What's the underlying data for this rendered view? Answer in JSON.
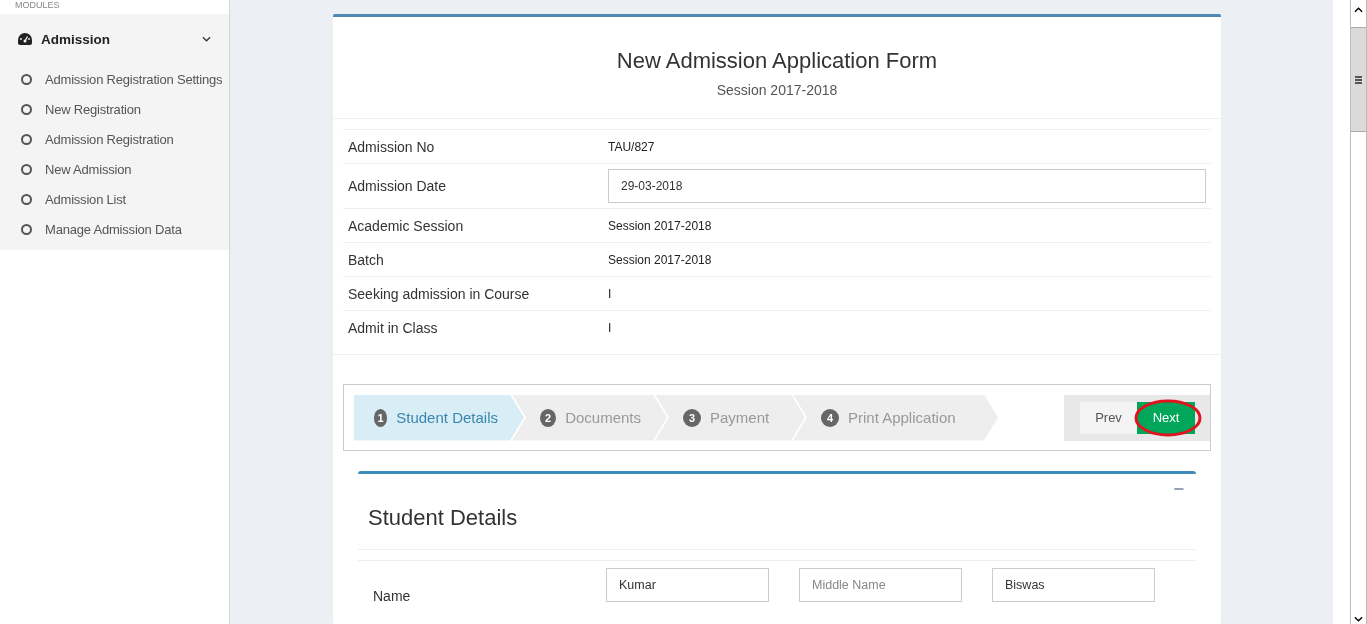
{
  "sidebar": {
    "section_label": "MODULES",
    "module": {
      "label": "Admission",
      "expanded": true
    },
    "items": [
      {
        "label": "Admission Registration Settings"
      },
      {
        "label": "New Registration"
      },
      {
        "label": "Admission Registration"
      },
      {
        "label": "New Admission"
      },
      {
        "label": "Admission List"
      },
      {
        "label": "Manage Admission Data"
      }
    ]
  },
  "form": {
    "title": "New Admission Application Form",
    "session": "Session 2017-2018",
    "fields": [
      {
        "kind": "text",
        "label": "Admission No",
        "value": "TAU/827"
      },
      {
        "kind": "input",
        "label": "Admission Date",
        "value": "29-03-2018"
      },
      {
        "kind": "text",
        "label": "Academic Session",
        "value": "Session 2017-2018"
      },
      {
        "kind": "text",
        "label": "Batch",
        "value": "Session 2017-2018"
      },
      {
        "kind": "text",
        "label": "Seeking admission in Course",
        "value": "I"
      },
      {
        "kind": "text",
        "label": "Admit in Class",
        "value": "I"
      }
    ]
  },
  "wizard": {
    "steps": [
      {
        "number": "1",
        "label": "Student Details",
        "selected": true
      },
      {
        "number": "2",
        "label": "Documents",
        "selected": false
      },
      {
        "number": "3",
        "label": "Payment",
        "selected": false
      },
      {
        "number": "4",
        "label": "Print Application",
        "selected": false
      }
    ],
    "prev_button": "Prev",
    "next_button": {
      "label": "Next",
      "circled": true
    }
  },
  "student_details": {
    "title": "Student Details",
    "collapse_icon": "−",
    "name_row": {
      "label": "Name",
      "inputs": [
        {
          "value": "Kumar"
        },
        {
          "placeholder": "Middle Name"
        },
        {
          "value": "Biswas"
        }
      ]
    }
  }
}
